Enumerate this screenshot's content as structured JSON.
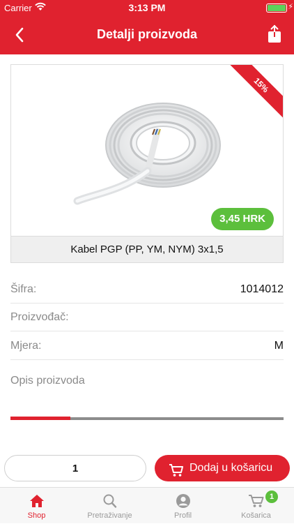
{
  "status_bar": {
    "carrier": "Carrier",
    "time": "3:13 PM"
  },
  "header": {
    "title": "Detalji proizvoda",
    "back_icon": "chevron-left-icon",
    "share_icon": "share-icon"
  },
  "product": {
    "name": "Kabel PGP (PP, YM, NYM) 3x1,5",
    "discount": "15%",
    "price": "3,45 HRK"
  },
  "details": [
    {
      "label": "Šifra:",
      "value": "1014012"
    },
    {
      "label": "Proizvođač:",
      "value": ""
    },
    {
      "label": "Mjera:",
      "value": "M"
    }
  ],
  "description_label": "Opis proizvoda",
  "description_progress": 0.22,
  "actions": {
    "quantity": "1",
    "add_to_cart": "Dodaj u košaricu"
  },
  "tabs": [
    {
      "label": "Shop",
      "icon": "home-icon",
      "active": true
    },
    {
      "label": "Pretraživanje",
      "icon": "search-icon",
      "active": false
    },
    {
      "label": "Profil",
      "icon": "user-icon",
      "active": false
    },
    {
      "label": "Košarica",
      "icon": "cart-icon",
      "active": false,
      "badge": "1"
    }
  ],
  "colors": {
    "brand": "#e0222f",
    "price_badge": "#5cbf3c"
  }
}
